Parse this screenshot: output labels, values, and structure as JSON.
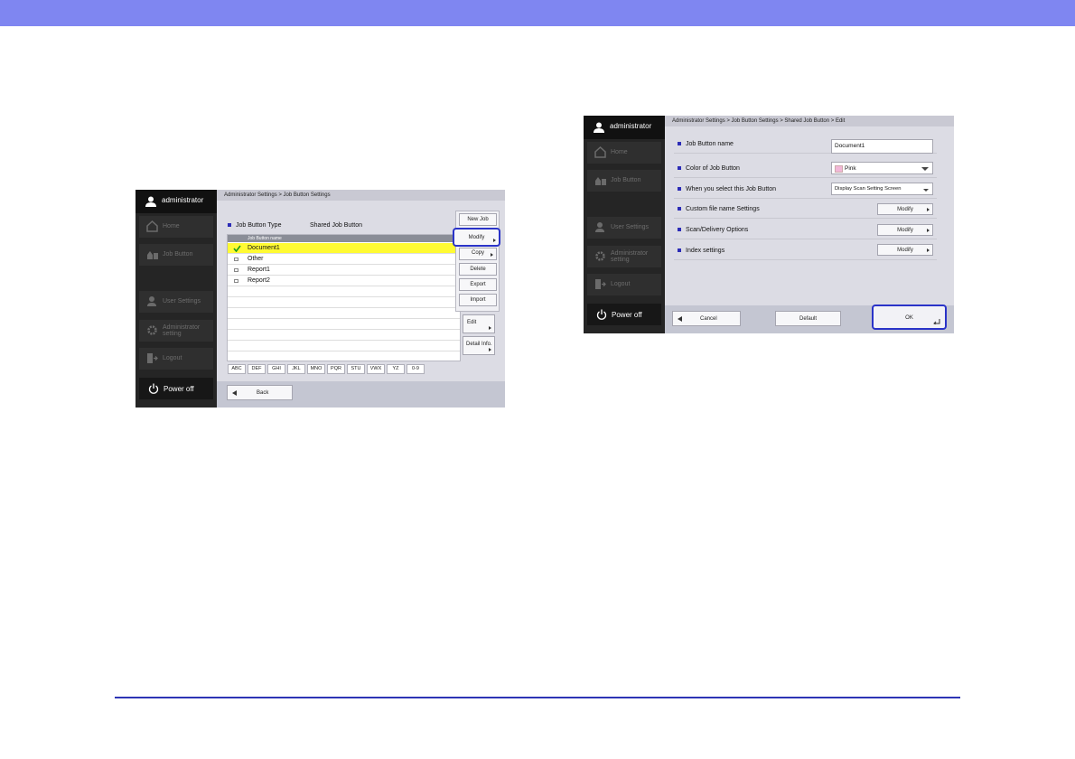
{
  "left_screen": {
    "user": "administrator",
    "sidebar": [
      {
        "label": "Home",
        "icon": "home-icon"
      },
      {
        "label": "Job Button",
        "icon": "job-button-icon"
      },
      {
        "label": "User Settings",
        "icon": "user-settings-icon"
      },
      {
        "label": "Administrator setting",
        "icon": "gear-icon"
      },
      {
        "label": "Logout",
        "icon": "logout-icon"
      }
    ],
    "power_off": "Power off",
    "breadcrumb": "Administrator Settings > Job Button Settings",
    "type_label": "Job Button Type",
    "type_value": "Shared Job Button",
    "list_header": "Job Button name",
    "rows": [
      "Document1",
      "Other",
      "Report1",
      "Report2"
    ],
    "buttons": {
      "new_job": "New Job",
      "modify": "Modify",
      "copy": "Copy",
      "delete": "Delete",
      "export": "Export",
      "import": "Import",
      "edit": "Edit",
      "detail_info": "Detail Info."
    },
    "alpha_tabs": [
      "ABC",
      "DEF",
      "GHI",
      "JKL",
      "MNO",
      "PQR",
      "STU",
      "VWX",
      "YZ",
      "0-9"
    ],
    "back": "Back"
  },
  "right_screen": {
    "user": "administrator",
    "sidebar": [
      {
        "label": "Home",
        "icon": "home-icon"
      },
      {
        "label": "Job Button",
        "icon": "job-button-icon"
      },
      {
        "label": "User Settings",
        "icon": "user-settings-icon"
      },
      {
        "label": "Administrator setting",
        "icon": "gear-icon"
      },
      {
        "label": "Logout",
        "icon": "logout-icon"
      }
    ],
    "power_off": "Power off",
    "breadcrumb": "Administrator Settings > Job Button Settings > Shared Job Button > Edit",
    "settings": {
      "name_label": "Job Button name",
      "name_value": "Document1",
      "color_label": "Color of Job Button",
      "color_value": "Pink",
      "color_swatch": "#f2b7d8",
      "select_label": "When you select this Job Button",
      "select_value": "Display Scan Setting Screen",
      "filename_label": "Custom file name Settings",
      "delivery_label": "Scan/Delivery Options",
      "index_label": "Index settings",
      "modify": "Modify"
    },
    "cancel": "Cancel",
    "default": "Default",
    "ok": "OK"
  }
}
